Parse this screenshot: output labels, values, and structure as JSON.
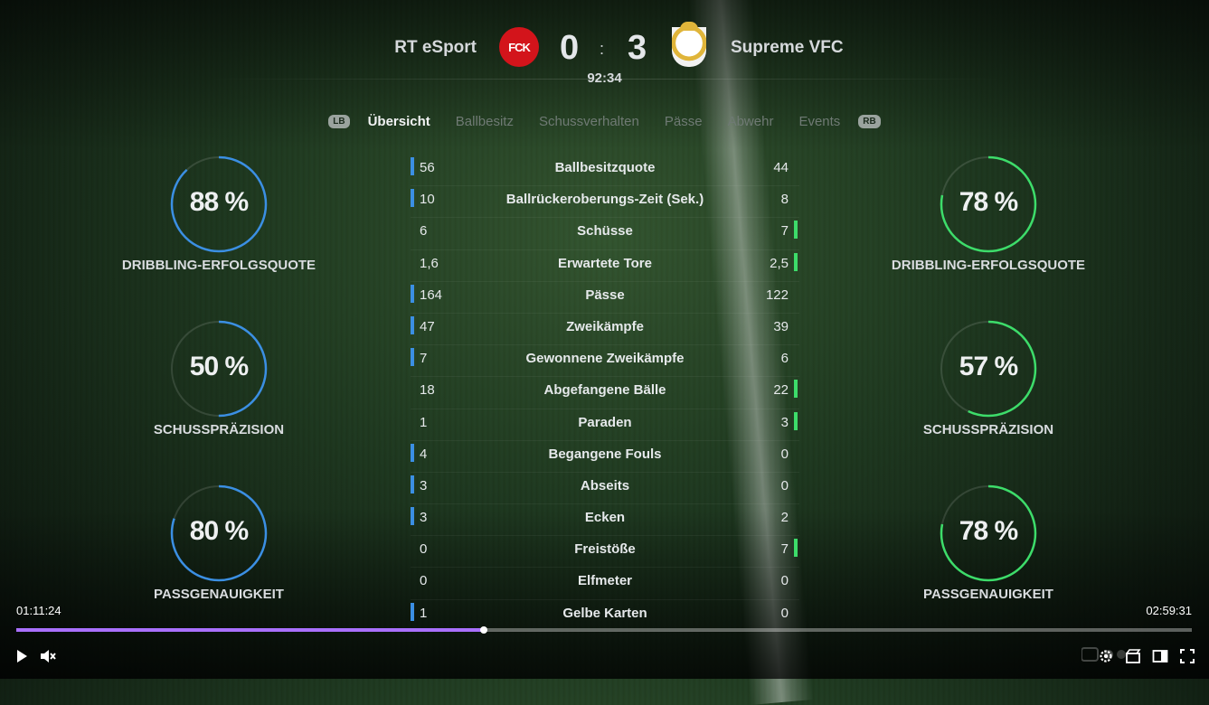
{
  "match": {
    "home_team": "RT eSport",
    "away_team": "Supreme VFC",
    "home_crest_text": "FCK",
    "home_score": "0",
    "away_score": "3",
    "separator": ":",
    "clock": "92:34"
  },
  "tabs": {
    "left_shoulder": "LB",
    "right_shoulder": "RB",
    "items": [
      "Übersicht",
      "Ballbesitz",
      "Schussverhalten",
      "Pässe",
      "Abwehr",
      "Events"
    ],
    "active_index": 0
  },
  "rings": {
    "home": [
      {
        "value": "88 %",
        "percent": 88,
        "label": "DRIBBLING-ERFOLGSQUOTE"
      },
      {
        "value": "50 %",
        "percent": 50,
        "label": "SCHUSSPRÄZISION"
      },
      {
        "value": "80 %",
        "percent": 80,
        "label": "PASSGENAUIGKEIT"
      }
    ],
    "away": [
      {
        "value": "78 %",
        "percent": 78,
        "label": "DRIBBLING-ERFOLGSQUOTE"
      },
      {
        "value": "57 %",
        "percent": 57,
        "label": "SCHUSSPRÄZISION"
      },
      {
        "value": "78 %",
        "percent": 78,
        "label": "PASSGENAUIGKEIT"
      }
    ]
  },
  "stats": [
    {
      "label": "Ballbesitzquote",
      "home": "56",
      "away": "44"
    },
    {
      "label": "Ballrückeroberungs-Zeit (Sek.)",
      "home": "10",
      "away": "8"
    },
    {
      "label": "Schüsse",
      "home": "6",
      "away": "7"
    },
    {
      "label": "Erwartete Tore",
      "home": "1,6",
      "away": "2,5"
    },
    {
      "label": "Pässe",
      "home": "164",
      "away": "122"
    },
    {
      "label": "Zweikämpfe",
      "home": "47",
      "away": "39"
    },
    {
      "label": "Gewonnene Zweikämpfe",
      "home": "7",
      "away": "6"
    },
    {
      "label": "Abgefangene Bälle",
      "home": "18",
      "away": "22"
    },
    {
      "label": "Paraden",
      "home": "1",
      "away": "3"
    },
    {
      "label": "Begangene Fouls",
      "home": "4",
      "away": "0"
    },
    {
      "label": "Abseits",
      "home": "3",
      "away": "0"
    },
    {
      "label": "Ecken",
      "home": "3",
      "away": "2"
    },
    {
      "label": "Freistöße",
      "home": "0",
      "away": "7"
    },
    {
      "label": "Elfmeter",
      "home": "0",
      "away": "0"
    },
    {
      "label": "Gelbe Karten",
      "home": "1",
      "away": "0"
    }
  ],
  "colors": {
    "home_accent": "#3b8fe3",
    "away_accent": "#3ddc6a",
    "progress": "#a970ff"
  },
  "player": {
    "current_time": "01:11:24",
    "total_time": "02:59:31",
    "progress_fraction": 0.3975
  }
}
